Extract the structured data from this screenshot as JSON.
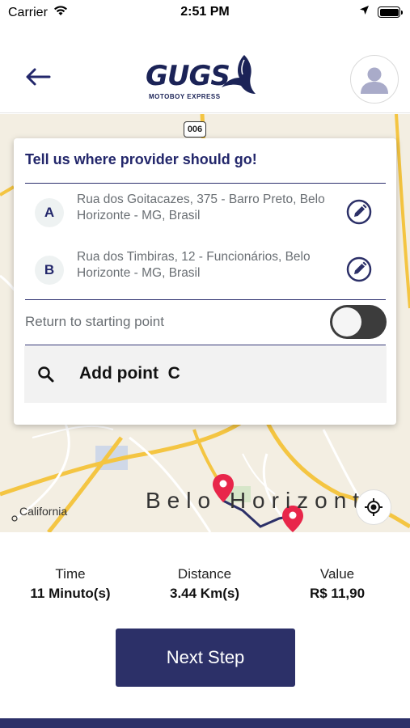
{
  "status_bar": {
    "carrier": "Carrier",
    "time": "2:51 PM"
  },
  "header": {
    "logo_word": "GUGS",
    "logo_subtitle": "MOTOBOY EXPRESS",
    "brand_color": "#1b2357"
  },
  "map": {
    "road_badge": "006",
    "city_label": "Belo Horizonte",
    "district_label": "California",
    "route_color": "#2c3068",
    "pin_color": "#e8264a"
  },
  "route_card": {
    "title": "Tell us where provider should go!",
    "stops": [
      {
        "letter": "A",
        "address": "Rua dos Goitacazes, 375 - Barro Preto, Belo Horizonte - MG, Brasil"
      },
      {
        "letter": "B",
        "address": "Rua dos Timbiras, 12 - Funcionários, Belo Horizonte - MG, Brasil"
      }
    ],
    "return_label": "Return to starting point",
    "return_toggle": "off",
    "add_point_label": "Add point  C"
  },
  "summary": {
    "time_label": "Time",
    "time_value": "11 Minuto(s)",
    "distance_label": "Distance",
    "distance_value": "3.44 Km(s)",
    "value_label": "Value",
    "value_value": "R$ 11,90"
  },
  "actions": {
    "next_label": "Next Step",
    "accent_color": "#2c3068"
  }
}
